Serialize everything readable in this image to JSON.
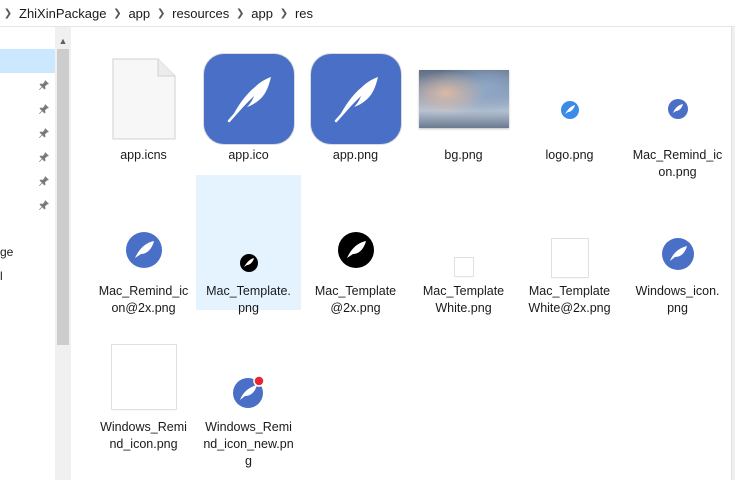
{
  "breadcrumb": {
    "items": [
      "ZhiXinPackage",
      "app",
      "resources",
      "app",
      "res"
    ]
  },
  "nav_pane": {
    "partial_items": [
      "ge",
      "l"
    ]
  },
  "files": [
    {
      "name": "app.icns",
      "label": "app.icns",
      "thumb": "blank-document-icon"
    },
    {
      "name": "app.ico",
      "label": "app.ico",
      "thumb": "feather-app-icon"
    },
    {
      "name": "app.png",
      "label": "app.png",
      "thumb": "feather-app-icon"
    },
    {
      "name": "bg.png",
      "label": "bg.png",
      "thumb": "blurred-background-image"
    },
    {
      "name": "logo.png",
      "label": "logo.png",
      "thumb": "logo-icon"
    },
    {
      "name": "Mac_Remind_icon.png",
      "label": "Mac_Remind_ic\non.png",
      "thumb": "remind-icon"
    },
    {
      "name": "Mac_Remind_icon@2x.png",
      "label": "Mac_Remind_ic\non@2x.png",
      "thumb": "remind-icon"
    },
    {
      "name": "Mac_Template.png",
      "label": "Mac_Template.\npng",
      "thumb": "template-icon",
      "selected": true
    },
    {
      "name": "Mac_Template@2x.png",
      "label": "Mac_Template\n@2x.png",
      "thumb": "template-icon"
    },
    {
      "name": "Mac_TemplateWhite.png",
      "label": "Mac_Template\nWhite.png",
      "thumb": "white-template-icon"
    },
    {
      "name": "Mac_TemplateWhite@2x.png",
      "label": "Mac_Template\nWhite@2x.png",
      "thumb": "white-template-icon"
    },
    {
      "name": "Windows_icon.png",
      "label": "Windows_icon.\npng",
      "thumb": "windows-icon"
    },
    {
      "name": "Windows_Remind_icon.png",
      "label": "Windows_Remi\nnd_icon.png",
      "thumb": "white-image-icon"
    },
    {
      "name": "Windows_Remind_icon_new.png",
      "label": "Windows_Remi\nnd_icon_new.pn\ng",
      "thumb": "remind-new-icon"
    }
  ],
  "colors": {
    "selection": "#e5f3ff",
    "nav_selection": "#cce8ff",
    "app_blue": "#4a6fc6",
    "badge_red": "#e8262d"
  }
}
